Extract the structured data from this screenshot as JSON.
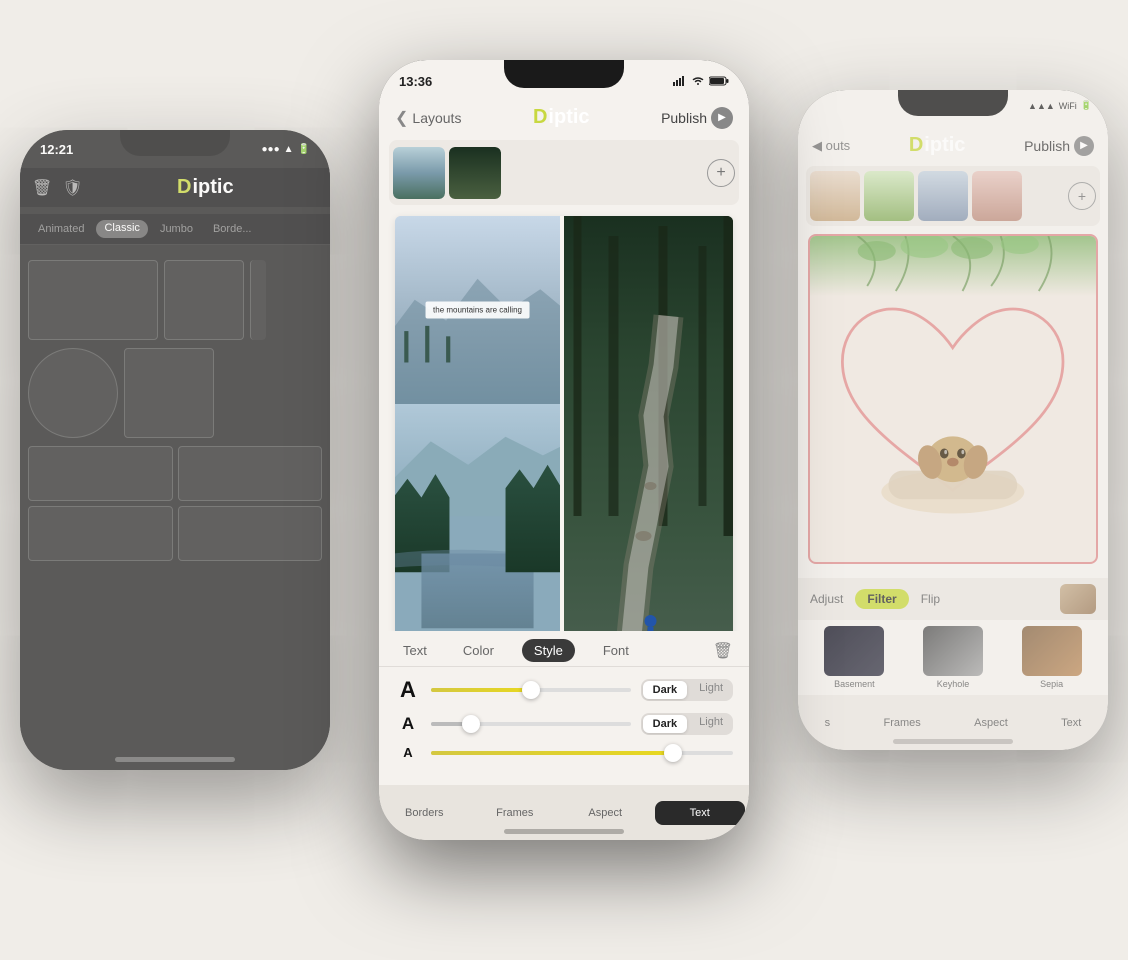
{
  "scene": {
    "background": "#f0ede8"
  },
  "left_phone": {
    "status": {
      "time": "12:21"
    },
    "app": {
      "name": "Diptic",
      "logo_d": "D"
    },
    "filter_tabs": [
      "Animated",
      "Classic",
      "Jumbo",
      "Border"
    ],
    "active_tab": "Classic"
  },
  "center_phone": {
    "status": {
      "time": "13:36"
    },
    "header": {
      "back_label": "Layouts",
      "app_name": "Diptic",
      "publish_label": "Publish"
    },
    "canvas": {
      "text_overlay": "the mountains are calling"
    },
    "tabs": {
      "items": [
        "Text",
        "Color",
        "Style",
        "Font"
      ],
      "active": "Style"
    },
    "controls": {
      "slider1_value": 50,
      "slider2_value": 20,
      "slider3_value": 80,
      "dark_light_1": {
        "options": [
          "Dark",
          "Light"
        ],
        "active": "Dark"
      },
      "dark_light_2": {
        "options": [
          "Dark",
          "Light"
        ],
        "active": "Dark"
      }
    },
    "bottom_tabs": [
      "Borders",
      "Frames",
      "Aspect",
      "Text"
    ],
    "active_bottom_tab": "Text"
  },
  "right_phone": {
    "status": {
      "time": ""
    },
    "header": {
      "back_label": "outs",
      "app_name": "Diptic",
      "publish_label": "Publish"
    },
    "filter_section": {
      "tabs": [
        "Adjust",
        "Filter",
        "Flip"
      ],
      "active": "Filter",
      "filters": [
        {
          "name": "Basement"
        },
        {
          "name": "Keyhole"
        },
        {
          "name": "Sepia"
        }
      ]
    },
    "bottom_tabs": [
      "s",
      "Frames",
      "Aspect",
      "Text"
    ]
  }
}
